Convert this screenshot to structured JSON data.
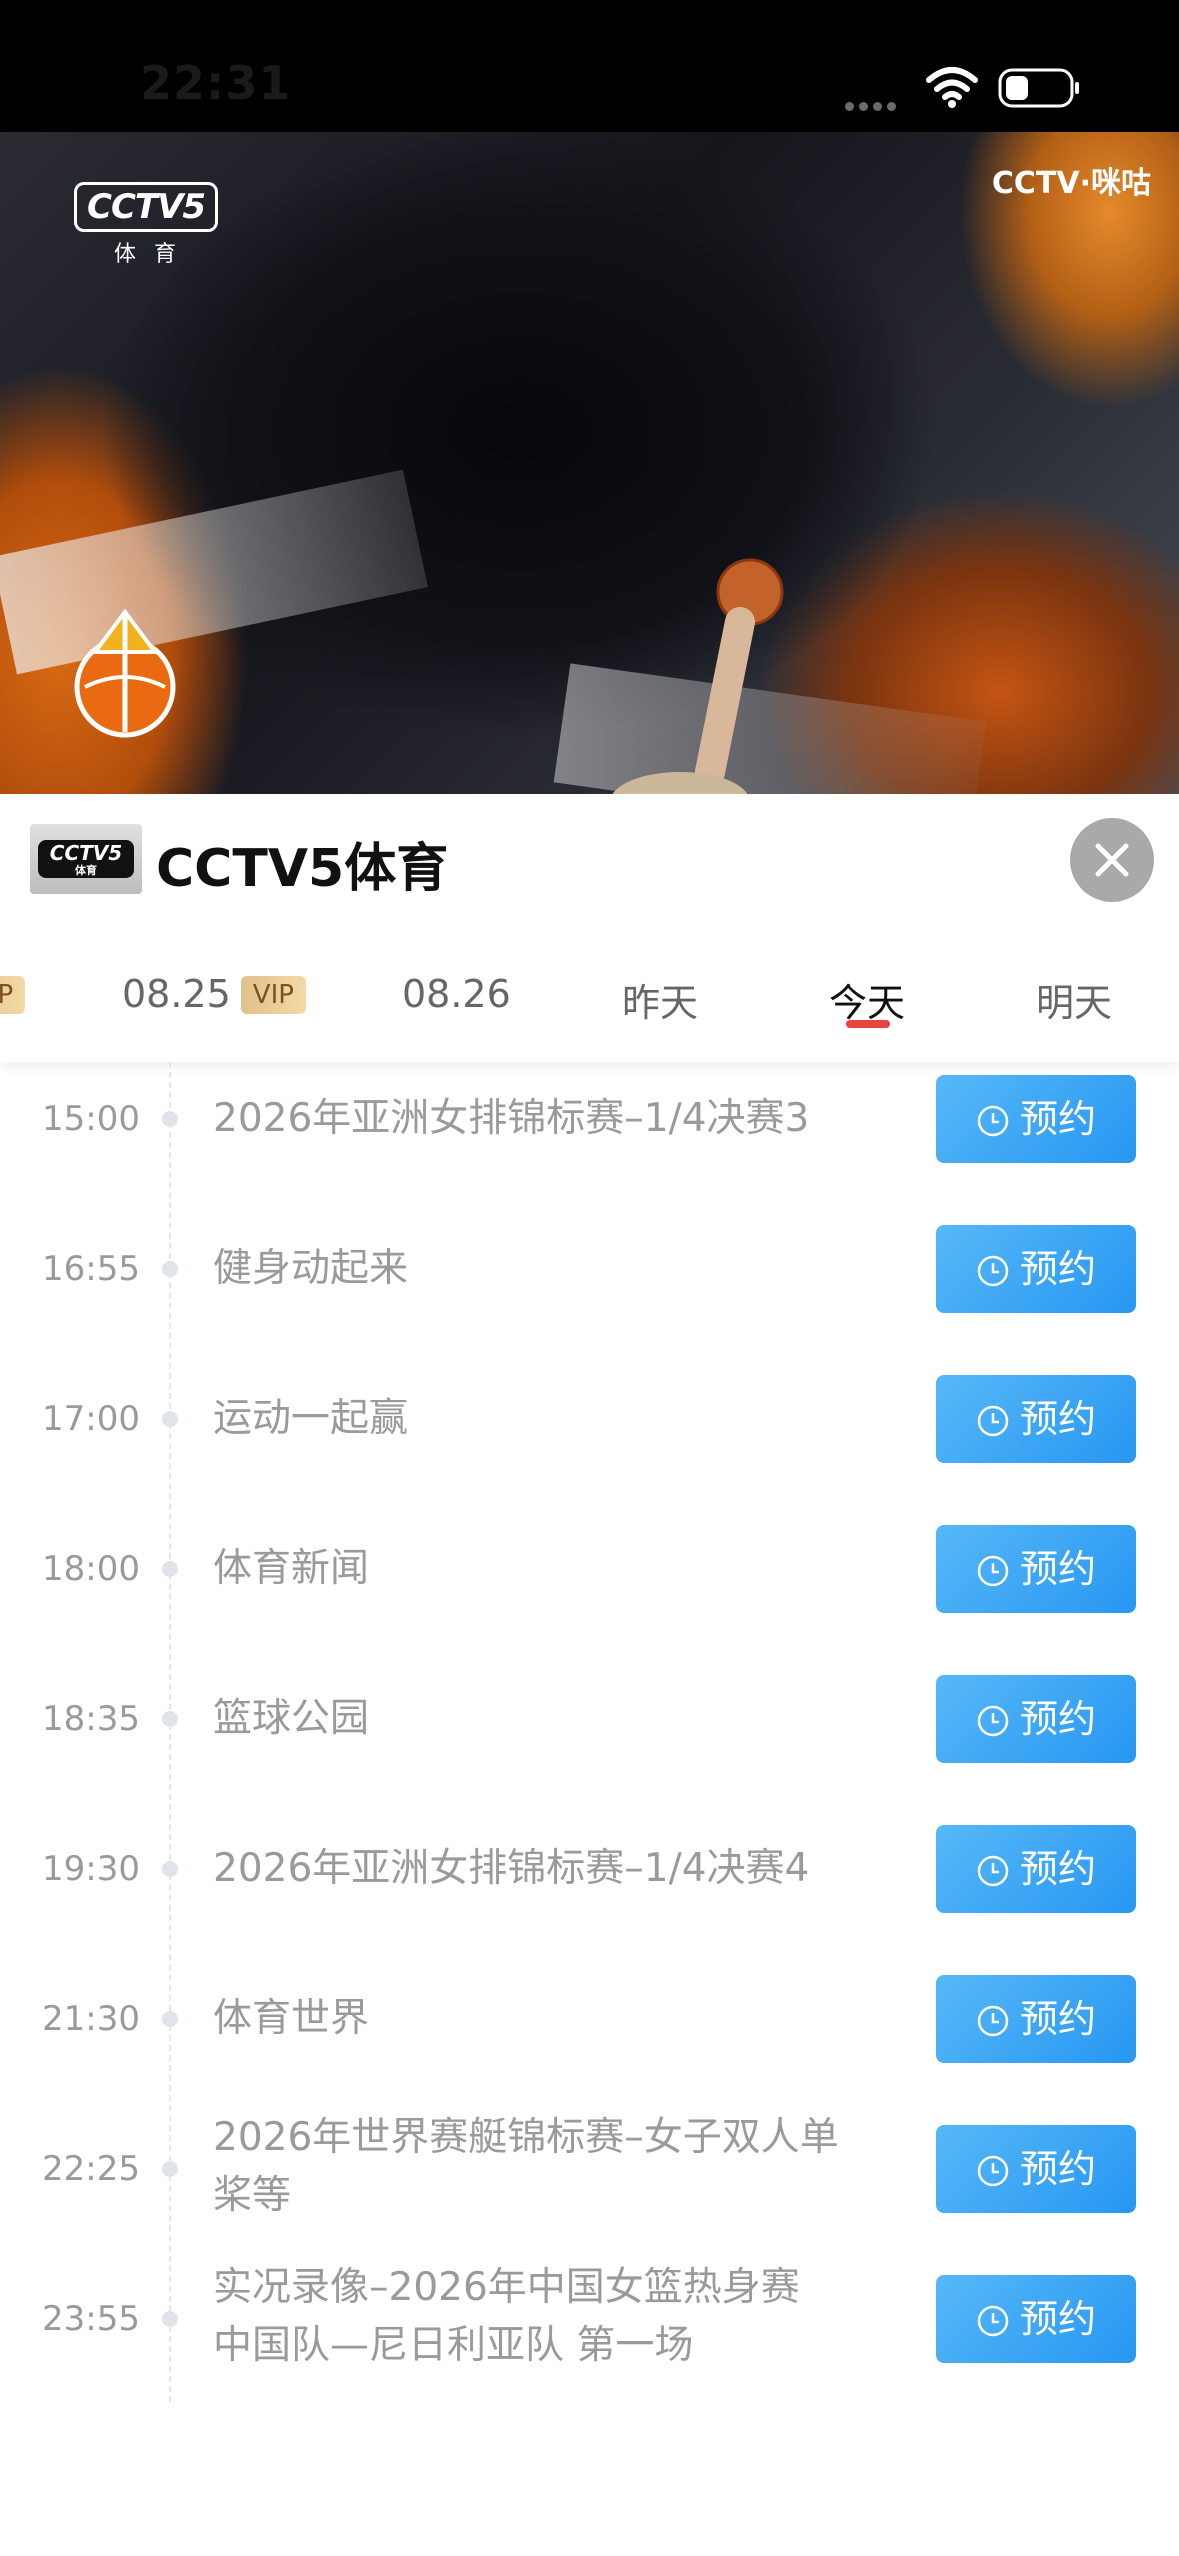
{
  "status_bar": {
    "time": "22:31"
  },
  "video": {
    "channel_watermark": "CCTV5",
    "channel_watermark_sub": "体育",
    "provider_watermark": "CCTV·咪咕"
  },
  "channel": {
    "name": "CCTV5体育",
    "logo_text": "CCTV5",
    "logo_sub": "体育"
  },
  "date_tabs": {
    "items": [
      {
        "label": "08.25",
        "badge": "VIP"
      },
      {
        "label": "08.26"
      },
      {
        "label": "昨天"
      },
      {
        "label": "今天",
        "active": true
      },
      {
        "label": "明天"
      }
    ],
    "partial_left_badge": "VIP"
  },
  "schedule": [
    {
      "time": "15:00",
      "title": "2026年亚洲女排锦标赛–1/4决赛3",
      "action": "预约"
    },
    {
      "time": "16:55",
      "title": "健身动起来",
      "action": "预约"
    },
    {
      "time": "17:00",
      "title": "运动一起赢",
      "action": "预约"
    },
    {
      "time": "18:00",
      "title": "体育新闻",
      "action": "预约"
    },
    {
      "time": "18:35",
      "title": "篮球公园",
      "action": "预约"
    },
    {
      "time": "19:30",
      "title": "2026年亚洲女排锦标赛–1/4决赛4",
      "action": "预约"
    },
    {
      "time": "21:30",
      "title": "体育世界",
      "action": "预约"
    },
    {
      "time": "22:25",
      "title_line1": "2026年世界赛艇锦标赛–女子双人单",
      "title_line2": "桨等",
      "action": "预约"
    },
    {
      "time": "23:55",
      "title_line1": "实况录像–2026年中国女篮热身赛",
      "title_line2": "中国队—尼日利亚队 第一场",
      "action": "预约"
    }
  ],
  "colors": {
    "accent_blue": "#2797f2",
    "active_underline": "#e8453c",
    "vip_gold": "#e2c08a"
  }
}
